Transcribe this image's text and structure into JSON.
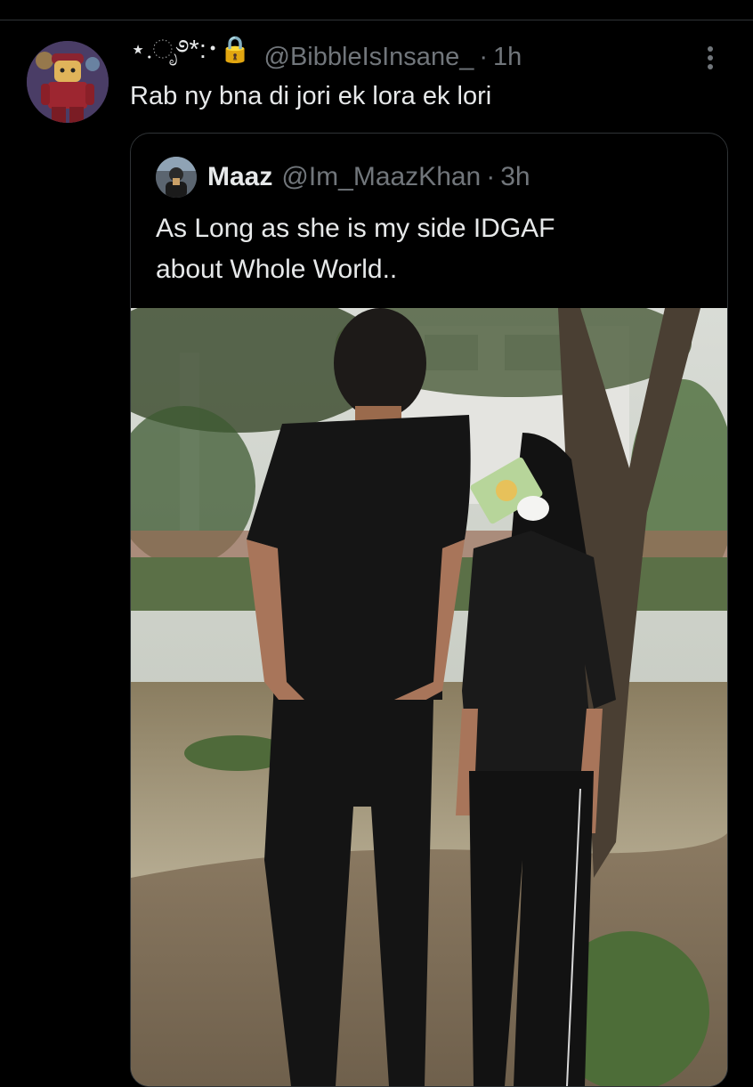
{
  "tweet": {
    "display_name": "⋆.ೃ࿔*:･🔒",
    "handle": "@BibbleIsInsane_",
    "separator": "·",
    "time": "1h",
    "text": "Rab ny bna di jori ek lora ek lori",
    "avatar_icon": "lego-character-avatar",
    "more_icon": "more-vertical-icon"
  },
  "quoted_tweet": {
    "display_name": "Maaz",
    "handle": "@Im_MaazKhan",
    "separator": "·",
    "time": "3h",
    "text_lines": [
      "As Long as she is my side IDGAF",
      "about Whole World.."
    ],
    "avatar_icon": "user-avatar",
    "media_description_icon": "photo-two-people-by-tree",
    "sticker_icon": "money-with-wings-emoji"
  },
  "colors": {
    "background": "#000000",
    "primary_text": "#e7e9ea",
    "secondary_text": "#71767b",
    "border": "#2f3336"
  }
}
